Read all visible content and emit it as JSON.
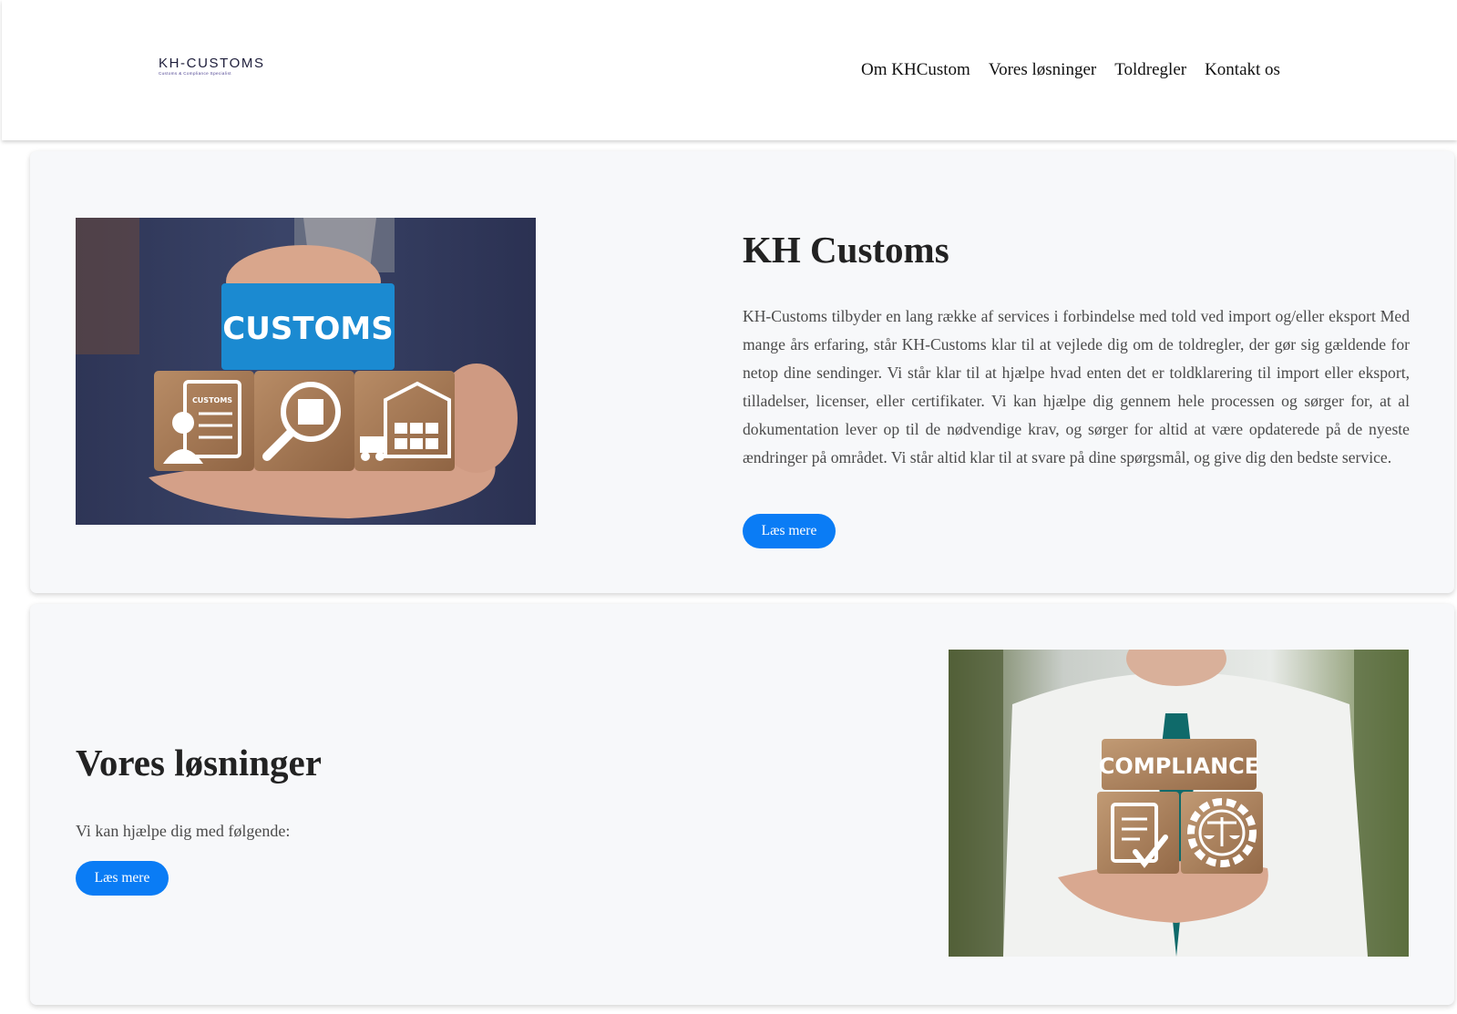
{
  "header": {
    "logo": {
      "main": "KH-CUSTOMS",
      "sub": "Customs & Compliance Specialist"
    },
    "nav": [
      "Om KHCustom",
      "Vores løsninger",
      "Toldregler",
      "Kontakt os"
    ]
  },
  "intro_section": {
    "title": "KH Customs",
    "description": "KH-Customs tilbyder en lang række af services i forbindelse med told ved import og/eller eksport Med mange års erfaring, står KH-Customs klar til at vejlede dig om de toldregler, der gør sig gældende for netop dine sendinger. Vi står klar til at hjælpe hvad enten det er toldklarering til import eller eksport, tilladelser, licenser, eller certifikater. Vi kan hjælpe dig gennem hele processen og sørger for, at al dokumentation lever op til de nødvendige krav, og sørger for altid at være opdaterede på de nyeste ændringer på området. Vi står altid klar til at svare på dine spørgsmål, og give dig den bedste service.",
    "button": "Læs mere",
    "image_label": "CUSTOMS",
    "image_small_label": "CUSTOMS"
  },
  "solutions_section": {
    "title": "Vores løsninger",
    "intro": "Vi kan hjælpe dig med følgende:",
    "button": "Læs mere",
    "image_label": "COMPLIANCE"
  },
  "colors": {
    "accent": "#0a7cf5",
    "card_bg": "#f7f8fa",
    "block_blue": "#1b8ad1",
    "wood": "#a77a55"
  }
}
